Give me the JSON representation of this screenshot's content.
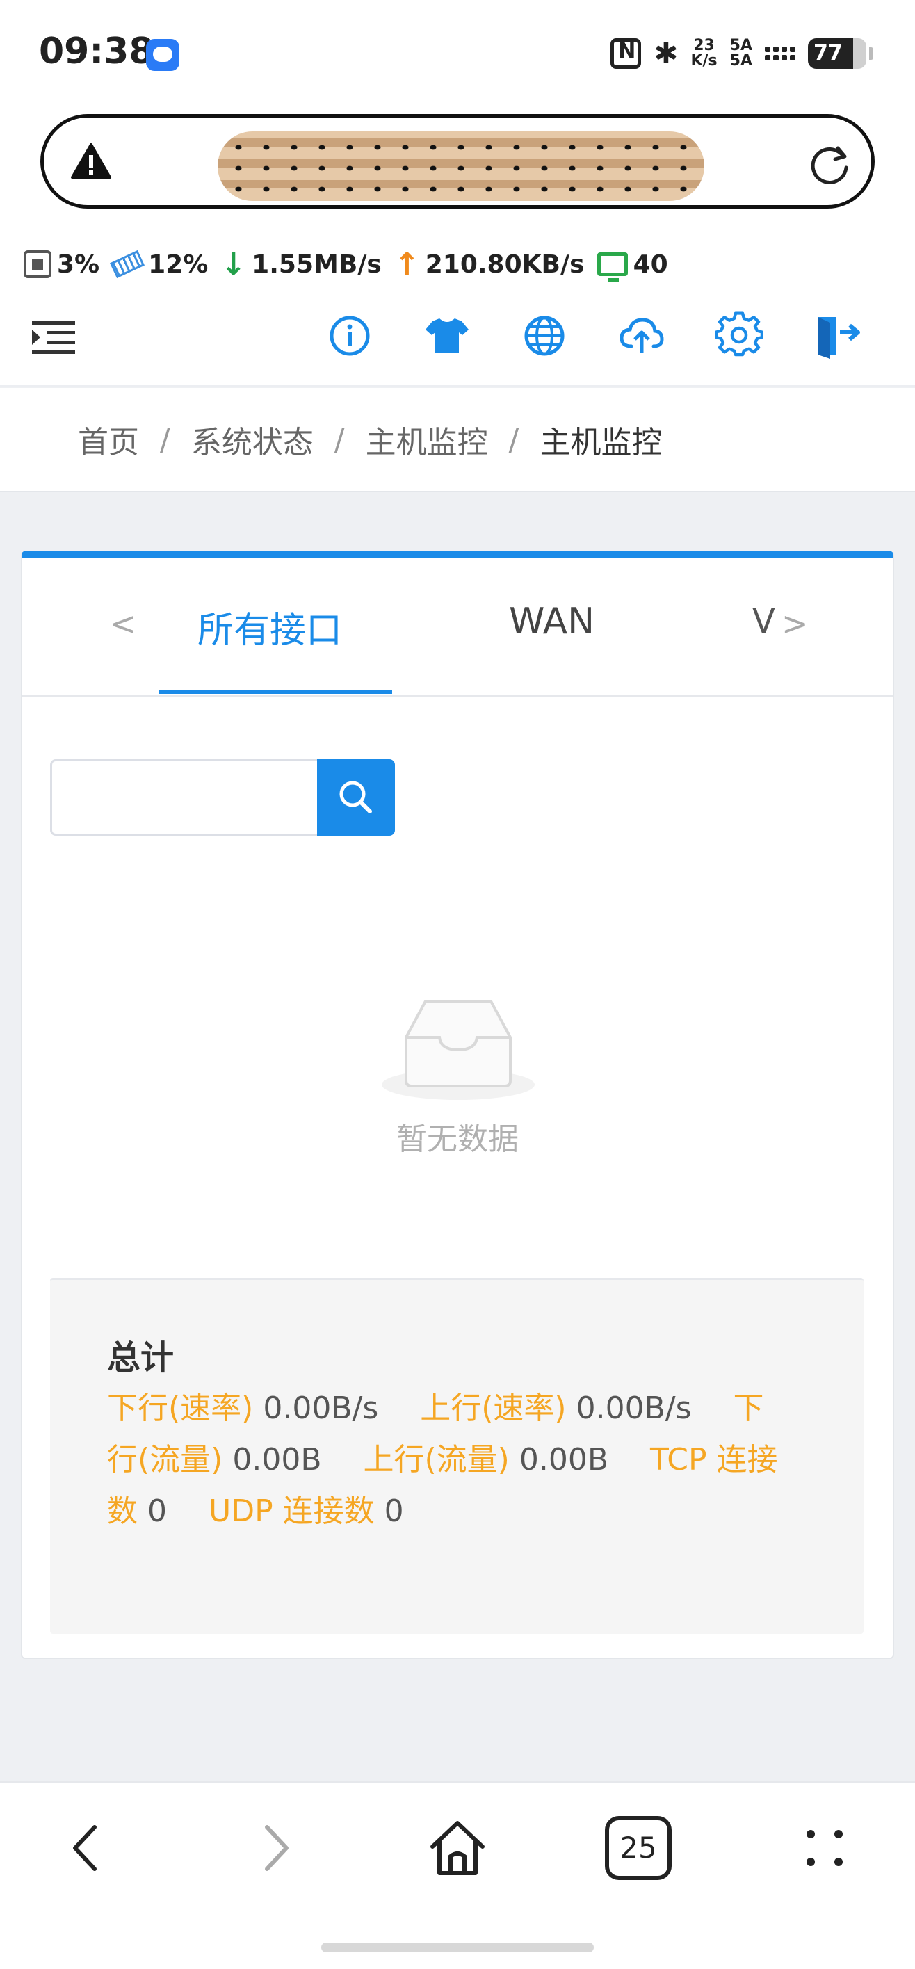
{
  "status_bar": {
    "time": "09:38",
    "net_speed_value": "23",
    "net_speed_unit": "K/s",
    "signal_1": "5A",
    "signal_2": "5A",
    "battery": "77",
    "battery_level": 0.77
  },
  "url_bar": {
    "warning_icon": "warning-triangle-icon",
    "reload_icon": "reload-icon"
  },
  "monitor": {
    "cpu": "3%",
    "ram": "12%",
    "download": "1.55MB/s",
    "upload": "210.80KB/s",
    "devices": "40"
  },
  "toolbar": {
    "icons": [
      "menu-collapse-icon",
      "info-icon",
      "shirt-icon",
      "globe-icon",
      "cloud-upload-icon",
      "gear-icon",
      "logout-icon"
    ]
  },
  "breadcrumb": [
    "首页",
    "系统状态",
    "主机监控",
    "主机监控"
  ],
  "tabs": {
    "items": [
      "所有接口",
      "WAN"
    ],
    "active": "所有接口",
    "clipped_label": "V"
  },
  "search": {
    "placeholder": ""
  },
  "empty": {
    "text": "暂无数据"
  },
  "summary": {
    "title": "总计",
    "down_rate_label": "下行(速率)",
    "down_rate_value": "0.00B/s",
    "up_rate_label": "上行(速率)",
    "up_rate_value": "0.00B/s",
    "down_traffic_label": "下行(流量)",
    "down_traffic_value": "0.00B",
    "up_traffic_label": "上行(流量)",
    "up_traffic_value": "0.00B",
    "tcp_label": "TCP 连接数",
    "tcp_value": "0",
    "udp_label": "UDP 连接数",
    "udp_value": "0"
  },
  "bottom_nav": {
    "tabs_count": "25"
  },
  "colors": {
    "accent": "#1a8be8",
    "label": "#f5a623",
    "download": "#22a04a",
    "upload": "#f08a1c"
  }
}
